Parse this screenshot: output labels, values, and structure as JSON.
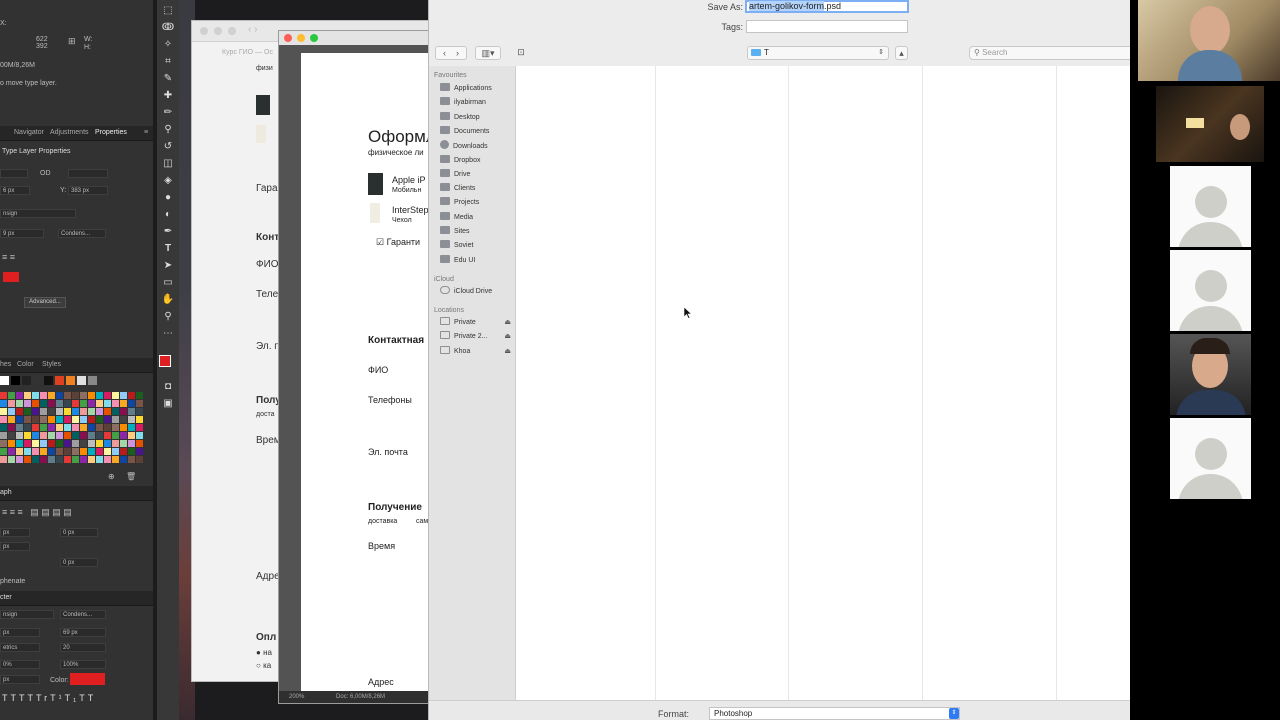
{
  "photoshop": {
    "info": {
      "x_label": "X:",
      "x_value": "622",
      "y_label": "Y:",
      "y_value": "392",
      "w_label": "W:",
      "h_label": "H:",
      "doc_size": "00M/8,26M",
      "hint": "o move type layer."
    },
    "panel_tabs": [
      "Navigator",
      "Adjustments",
      "Properties"
    ],
    "properties_title": "Type Layer Properties",
    "props": {
      "oo": "OD",
      "w_val": "6 px",
      "y_label": "Y:",
      "y_val": "383 px",
      "font": "nsign",
      "size": "9 px",
      "style": "Condens...",
      "advanced": "Advanced..."
    },
    "swatch_tabs": [
      "hes",
      "Color",
      "Styles"
    ],
    "paragraph_title": "aph",
    "paragraph": {
      "indent1": "0 px",
      "indent2": "0 px",
      "indent3": "0 px",
      "left": "px",
      "right": "px",
      "hyphenate": "phenate"
    },
    "character_title": "cter",
    "character": {
      "font": "nsign",
      "style": "Condens...",
      "size": "px",
      "leading": "69 px",
      "tracking_label": "etrics",
      "tracking": "20",
      "scale1": "0%",
      "scale2": "100%",
      "baseline": "px",
      "color_label": "Color:",
      "type_styles": [
        "T",
        "T",
        "TT",
        "Tr",
        "T¹",
        "T₁",
        "T",
        "T"
      ]
    },
    "doc_zoom": "200%",
    "doc_status": "Doc: 6,00M/8,26M"
  },
  "bg_window": {
    "title": "Курс ГИО — Ос",
    "lines": [
      "физи",
      "Гара",
      "Конт",
      "ФИО",
      "Теле",
      "Эл. п",
      "Полу",
      "доста",
      "Врем",
      "Адре",
      "Опл",
      "на",
      "ка"
    ]
  },
  "document": {
    "heading": "Оформл",
    "subheading": "физическое ли",
    "items": [
      {
        "name": "Apple iP",
        "desc": "Мобильн"
      },
      {
        "name": "InterStep",
        "desc": "Чехол"
      }
    ],
    "warranty": "Гаранти",
    "contact_title": "Контактная",
    "fio": "ФИО",
    "phones": "Телефоны",
    "email": "Эл. почта",
    "receive_title": "Получение",
    "delivery": "доставка",
    "pickup": "сам",
    "time": "Время",
    "address": "Адрес"
  },
  "dialog": {
    "save_as_label": "Save As:",
    "filename_selected": "artem-golikov-form",
    "filename_ext": ".psd",
    "tags_label": "Tags:",
    "location": "T",
    "search_placeholder": "Search",
    "sidebar": {
      "favourites_title": "Favourites",
      "favourites": [
        "Applications",
        "ilyabirman",
        "Desktop",
        "Documents",
        "Downloads",
        "Dropbox",
        "Drive",
        "Clients",
        "Projects",
        "Media",
        "Sites",
        "Soviet",
        "Edu UI"
      ],
      "icloud_title": "iCloud",
      "icloud": [
        "iCloud Drive"
      ],
      "locations_title": "Locations",
      "locations": [
        "Private",
        "Private 2...",
        "Khoa"
      ]
    },
    "format_label": "Format:",
    "format_value": "Photoshop"
  },
  "colors": {
    "accent": "#2f7bf5",
    "selection": "#b3d3fb",
    "ps_red": "#e02020"
  }
}
